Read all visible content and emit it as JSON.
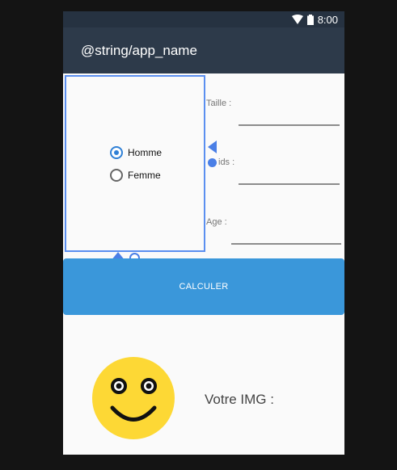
{
  "status_bar": {
    "time": "8:00",
    "icons": [
      "wifi-icon",
      "battery-icon"
    ]
  },
  "app_bar": {
    "title": "@string/app_name"
  },
  "gender": {
    "options": [
      {
        "label": "Homme",
        "checked": true
      },
      {
        "label": "Femme",
        "checked": false
      }
    ]
  },
  "fields": {
    "taille": {
      "label": "Taille :"
    },
    "poids": {
      "label": "ids :"
    },
    "age": {
      "label": "Age :"
    }
  },
  "calculate_button": {
    "label": "CALCULER"
  },
  "result": {
    "label": "Votre IMG :",
    "icon": "smiley-icon"
  },
  "colors": {
    "accent": "#3a97da",
    "app_bar": "#2d3a4a",
    "selection": "#5b8ff0",
    "smiley": "#fdd835"
  }
}
